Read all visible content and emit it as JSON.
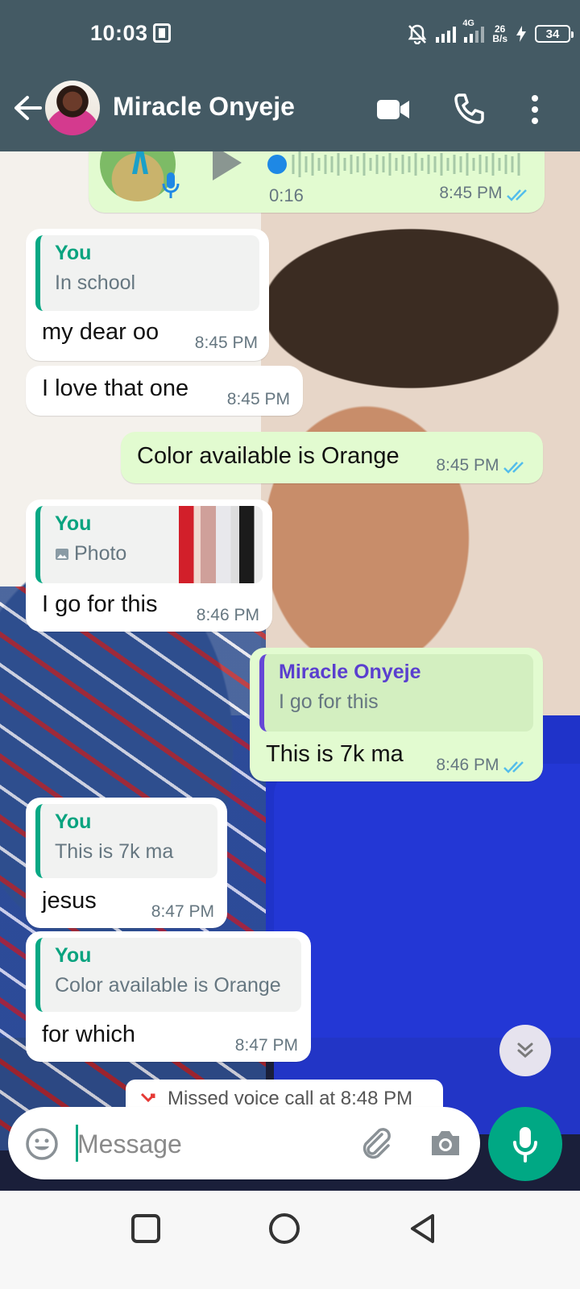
{
  "status_bar": {
    "time": "10:03",
    "network_type": "4G",
    "data_speed_value": "26",
    "data_speed_unit": "B/s",
    "battery": "34"
  },
  "header": {
    "contact_name": "Miracle Onyeje"
  },
  "voice_note": {
    "duration": "0:16",
    "time": "8:45 PM"
  },
  "messages": [
    {
      "direction": "in",
      "quote_author": "You",
      "quote_text": "In school",
      "text": "my dear oo",
      "time": "8:45 PM"
    },
    {
      "direction": "in",
      "text": "I love that one",
      "time": "8:45 PM"
    },
    {
      "direction": "out",
      "text": "Color available is Orange",
      "time": "8:45 PM"
    },
    {
      "direction": "in",
      "quote_author": "You",
      "quote_text": "Photo",
      "text": "I go for this",
      "time": "8:46 PM"
    },
    {
      "direction": "out",
      "quote_author": "Miracle Onyeje",
      "quote_text": "I go for this",
      "text": "This is 7k ma",
      "time": "8:46 PM"
    },
    {
      "direction": "in",
      "quote_author": "You",
      "quote_text": "This is 7k ma",
      "text": "jesus",
      "time": "8:47 PM"
    },
    {
      "direction": "in",
      "quote_author": "You",
      "quote_text": "Color available is Orange",
      "text": "for which",
      "time": "8:47 PM"
    }
  ],
  "system_notice": "Missed voice call at 8:48 PM",
  "composer": {
    "placeholder": "Message"
  },
  "colors": {
    "header_bg": "#445a64",
    "accent": "#00a884",
    "outgoing_bubble": "#e2fbd0",
    "incoming_bubble": "#ffffff",
    "read_ticks": "#53bdeb"
  },
  "icons": [
    "back-arrow-icon",
    "video-call-icon",
    "phone-icon",
    "more-vert-icon",
    "mic-icon",
    "play-icon",
    "emoji-icon",
    "attach-icon",
    "camera-icon",
    "scroll-down-icon",
    "missed-call-icon",
    "square-nav-icon",
    "circle-nav-icon",
    "triangle-nav-icon"
  ]
}
